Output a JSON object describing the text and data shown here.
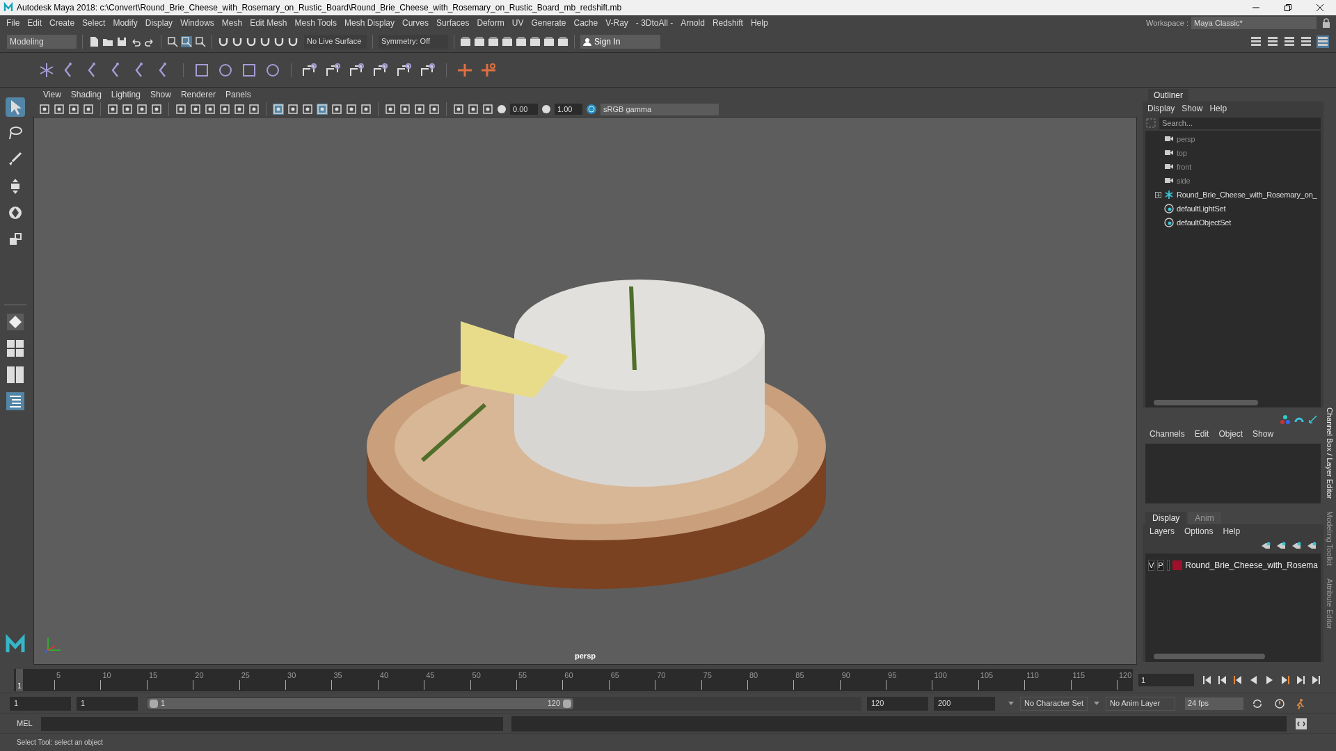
{
  "window": {
    "title": "Autodesk Maya 2018: c:\\Convert\\Round_Brie_Cheese_with_Rosemary_on_Rustic_Board\\Round_Brie_Cheese_with_Rosemary_on_Rustic_Board_mb_redshift.mb"
  },
  "menu_bar": [
    "File",
    "Edit",
    "Create",
    "Select",
    "Modify",
    "Display",
    "Windows",
    "Mesh",
    "Edit Mesh",
    "Mesh Tools",
    "Mesh Display",
    "Curves",
    "Surfaces",
    "Deform",
    "UV",
    "Generate",
    "Cache",
    "V-Ray",
    "- 3DtoAll -",
    "Arnold",
    "Redshift",
    "Help"
  ],
  "workspace": {
    "label": "Workspace :",
    "value": "Maya Classic*"
  },
  "status_line": {
    "mode": "Modeling",
    "live_surface": "No Live Surface",
    "symmetry": "Symmetry: Off",
    "sign_in": "Sign In"
  },
  "toolbox": [
    {
      "kind": "select",
      "selected": true
    },
    {
      "kind": "lasso",
      "selected": false
    },
    {
      "kind": "paint",
      "selected": false
    },
    {
      "kind": "move",
      "selected": false
    },
    {
      "kind": "rotate",
      "selected": false
    },
    {
      "kind": "scale",
      "selected": false
    }
  ],
  "viewport": {
    "menu": [
      "View",
      "Shading",
      "Lighting",
      "Show",
      "Renderer",
      "Panels"
    ],
    "exposure": "0.00",
    "gamma": "1.00",
    "color_space": "sRGB gamma",
    "camera_label": "persp"
  },
  "outliner": {
    "title": "Outliner",
    "menu": [
      "Display",
      "Show",
      "Help"
    ],
    "search_placeholder": "Search...",
    "items": [
      {
        "kind": "camera",
        "label": "persp",
        "dimmed": true,
        "expandable": false
      },
      {
        "kind": "camera",
        "label": "top",
        "dimmed": true,
        "expandable": false
      },
      {
        "kind": "camera",
        "label": "front",
        "dimmed": true,
        "expandable": false
      },
      {
        "kind": "camera",
        "label": "side",
        "dimmed": true,
        "expandable": false
      },
      {
        "kind": "transform",
        "label": "Round_Brie_Cheese_with_Rosemary_on_",
        "dimmed": false,
        "expandable": true
      },
      {
        "kind": "set",
        "label": "defaultLightSet",
        "dimmed": false,
        "expandable": false
      },
      {
        "kind": "set",
        "label": "defaultObjectSet",
        "dimmed": false,
        "expandable": false
      }
    ]
  },
  "channel_box": {
    "menu": [
      "Channels",
      "Edit",
      "Object",
      "Show"
    ]
  },
  "layer_editor": {
    "tabs": [
      {
        "label": "Display",
        "selected": true
      },
      {
        "label": "Anim",
        "selected": false
      }
    ],
    "menu": [
      "Layers",
      "Options",
      "Help"
    ],
    "layers": [
      {
        "visible_label": "V",
        "playback_label": "P",
        "name": "Round_Brie_Cheese_with_Rosema",
        "color": "#a0102a"
      }
    ]
  },
  "side_tabs": [
    "Channel Box / Layer Editor",
    "Modeling Toolkit",
    "Attribute Editor"
  ],
  "time_slider": {
    "ticks": [
      "5",
      "10",
      "15",
      "20",
      "25",
      "30",
      "35",
      "40",
      "45",
      "50",
      "55",
      "60",
      "65",
      "70",
      "75",
      "80",
      "85",
      "90",
      "95",
      "100",
      "105",
      "110",
      "115",
      "120"
    ],
    "current": "1",
    "level": 0,
    "current_field": "1"
  },
  "range_slider": {
    "start": "1",
    "playback_start": "1",
    "range_start": "1",
    "range_end": "120",
    "playback_end": "120",
    "end": "200",
    "character_set": "No Character Set",
    "anim_layer": "No Anim Layer",
    "fps": "24 fps"
  },
  "command_line": {
    "label": "MEL"
  },
  "help_line": "Select Tool: select an object"
}
